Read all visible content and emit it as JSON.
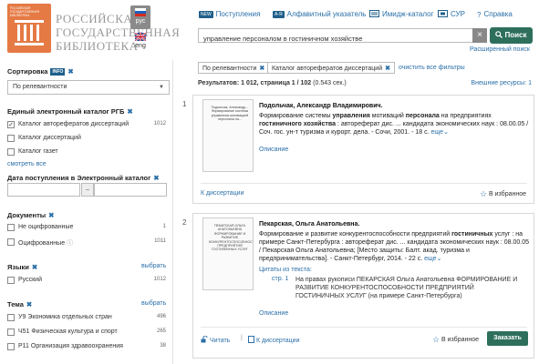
{
  "header": {
    "logo_small": "РОССИЙСКАЯ ГОСУДАРСТВЕННАЯ БИБЛИОТЕКА",
    "logo_line1": "РОССИЙСКАЯ",
    "logo_line2": "ГОСУДАРСТВЕННАЯ",
    "logo_line3": "БИБЛИОТЕКА",
    "lang_ru": "рус",
    "lang_en": "eng",
    "nav": {
      "new_badge": "NEW",
      "new_label": "Поступления",
      "az_badge": "A-Я",
      "az_label": "Алфавитный указатель",
      "image_catalog": "Имидж-каталог",
      "sur": "СУР",
      "help": "Справка"
    },
    "search": {
      "value": "управление персоналом в гостиничном хозяйстве",
      "button": "Поиск",
      "advanced": "Расширенный поиск"
    }
  },
  "sidebar": {
    "sort": {
      "title": "Сортировка",
      "info": "INFO",
      "value": "По релевантности"
    },
    "catalog": {
      "title": "Единый электронный каталог РГБ",
      "items": [
        {
          "label": "Каталог авторефератов диссертаций",
          "count": "1012",
          "checked": "✓"
        },
        {
          "label": "Каталог диссертаций",
          "count": "",
          "checked": ""
        },
        {
          "label": "Каталог газет",
          "count": "",
          "checked": ""
        }
      ],
      "more": "смотреть все"
    },
    "date": {
      "title": "Дата поступления в Электронный каталог",
      "sep": "–"
    },
    "docs": {
      "title": "Документы",
      "items": [
        {
          "label": "Не оцифрованные",
          "count": "1"
        },
        {
          "label": "Оцифрованные",
          "count": "1011"
        }
      ]
    },
    "lang": {
      "title": "Языки",
      "choose": "выбрать",
      "items": [
        {
          "label": "Русский",
          "count": "1012"
        }
      ]
    },
    "topic": {
      "title": "Тема",
      "choose": "выбрать",
      "items": [
        {
          "label": "У9 Экономика отдельных стран",
          "count": "496"
        },
        {
          "label": "Ч51 Физическая культура и спорт",
          "count": "265"
        },
        {
          "label": "Р11 Организация здравоохранения",
          "count": "38"
        }
      ]
    }
  },
  "main": {
    "filters": [
      "По релевантности",
      "Каталог авторефератов диссертаций"
    ],
    "clear_filters": "очистить все фильтры",
    "results_label": "Результатов: 1 012, страница 1 / 102",
    "results_time": "(0.543 сек.)",
    "external": "Внешние ресурсы: 1",
    "results": [
      {
        "num": "1",
        "thumb_text": "Подольчак, Александр... Формирование системы управления мотивацией персонала на...",
        "author": "Подольчак, Александр Владимирович.",
        "desc_pre": "Формирование системы ",
        "desc_b1": "управления",
        "desc_mid": " мотиваций ",
        "desc_b2": "персонала",
        "desc_rest": " на предприятиях ",
        "desc_b3": "гостиничного хозяйства",
        "desc_tail": " : автореферат дис. ... кандидата экономических наук : 08.00.05 / Соч. гос. ун-т туризма и курорт. дела. - Сочи, 2001. - 18 с.",
        "more_link": "еще",
        "desc_link": "Описание",
        "to_diss": "К диссертации",
        "fav": "В избранное"
      },
      {
        "num": "2",
        "thumb_text": "ПЕКАРСКАЯ ОЛЬГА АНАТОЛЬЕВНА ФОРМИРОВАНИЕ И РАЗВИТИЕ КОНКУРЕНТОСПОСОБНОСТИ ПРЕДПРИЯТИЙ ГОСТИНИЧНЫХ УСЛУГ",
        "author": "Пекарская, Ольга Анатольевна.",
        "desc_pre": "Формирование и развитие конкурентоспособности предприятий ",
        "desc_b1": "гостиничных",
        "desc_tail": " услуг : на примере Санкт-Петербурга : автореферат дис. ... кандидата экономических наук : 08.00.05 / Пекарская Ольга Анатольевна; [Место защиты: Балт. акад. туризма и предпринимательства]. - Санкт-Петербург, 2014. - 22 с.",
        "more_link": "еще",
        "cite_label": "Цитаты из текста:",
        "cite_page": "стр. 1",
        "cite_text": "На правах рукописи ПЕКАРСКАЯ Ольга Анатольевна ФОРМИРОВАНИЕ И РАЗВИТИЕ КОНКУРЕНТОСПОСОБНОСТИ ПРЕДПРИЯТИЙ ГОСТИНИЧНЫХ УСЛУГ (на примере Санкт-Петербурга)",
        "desc_link": "Описание",
        "read": "Читать",
        "to_diss": "К диссертации",
        "fav": "В избранное",
        "order": "Заказать"
      }
    ]
  },
  "colors": {
    "brand": "#e57a44",
    "accent": "#2e6f5c",
    "link": "#2a6fa8"
  }
}
